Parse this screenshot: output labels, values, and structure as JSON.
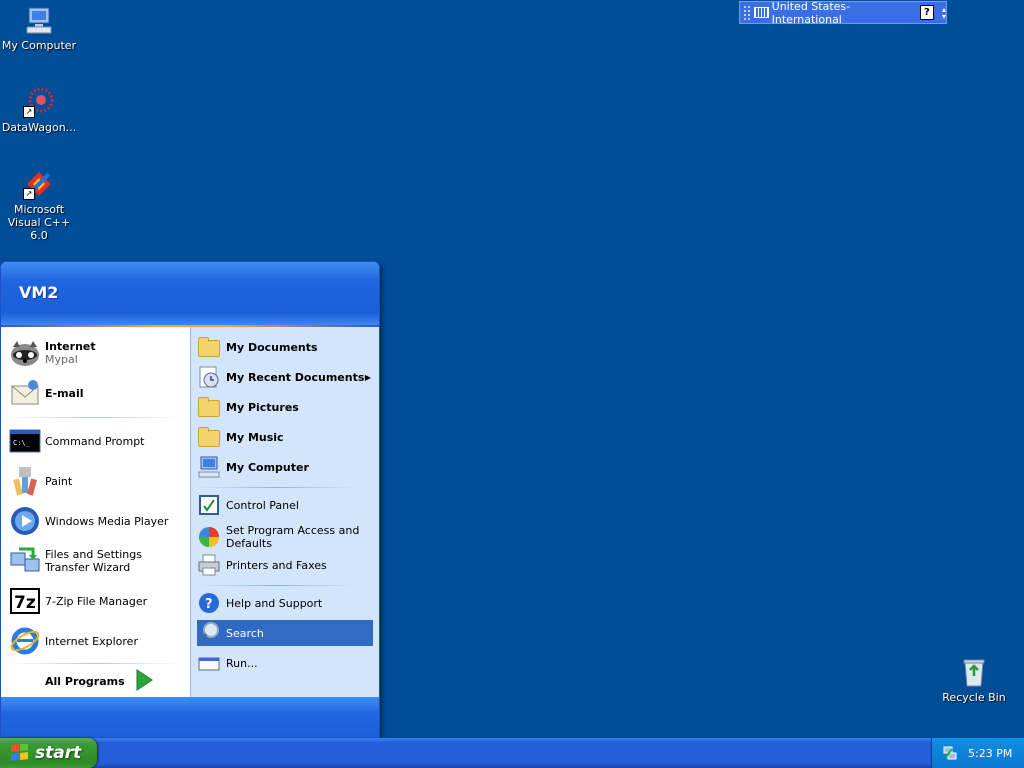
{
  "desktop": {
    "icons": [
      {
        "label": "My Computer",
        "icon": "my-computer-icon"
      },
      {
        "label": "DataWagon...",
        "icon": "datawagon-icon"
      },
      {
        "label": "Microsoft Visual C++ 6.0",
        "icon": "visual-cpp-icon"
      }
    ],
    "recycle_bin": {
      "label": "Recycle Bin",
      "icon": "recycle-bin-icon"
    }
  },
  "language_bar": {
    "language": "United States-International",
    "help": "?"
  },
  "start_menu": {
    "user": "VM2",
    "pinned": [
      {
        "title": "Internet",
        "subtitle": "Mypal",
        "icon": "mypal-icon"
      },
      {
        "title": "E-mail",
        "icon": "email-icon"
      }
    ],
    "recent": [
      {
        "label": "Command Prompt",
        "icon": "command-prompt-icon"
      },
      {
        "label": "Paint",
        "icon": "paint-icon"
      },
      {
        "label": "Windows Media Player",
        "icon": "media-player-icon"
      },
      {
        "label": "Files and Settings Transfer Wizard",
        "icon": "transfer-wizard-icon"
      },
      {
        "label": "7-Zip File Manager",
        "icon": "7zip-icon"
      },
      {
        "label": "Internet Explorer",
        "icon": "internet-explorer-icon"
      }
    ],
    "all_programs": "All Programs",
    "places": [
      {
        "label": "My Documents",
        "icon": "folder-icon"
      },
      {
        "label": "My Recent Documents",
        "icon": "recent-documents-icon"
      },
      {
        "label": "My Pictures",
        "icon": "folder-icon"
      },
      {
        "label": "My Music",
        "icon": "folder-icon"
      },
      {
        "label": "My Computer",
        "icon": "my-computer-icon"
      }
    ],
    "system": [
      {
        "label": "Control Panel",
        "icon": "control-panel-icon"
      },
      {
        "label": "Set Program Access and Defaults",
        "icon": "program-access-icon"
      },
      {
        "label": "Printers and Faxes",
        "icon": "printer-icon"
      }
    ],
    "actions": [
      {
        "label": "Help and Support",
        "icon": "help-icon"
      },
      {
        "label": "Search",
        "icon": "search-icon",
        "selected": true
      },
      {
        "label": "Run...",
        "icon": "run-icon"
      }
    ]
  },
  "taskbar": {
    "start_label": "start",
    "clock": "5:23 PM"
  }
}
